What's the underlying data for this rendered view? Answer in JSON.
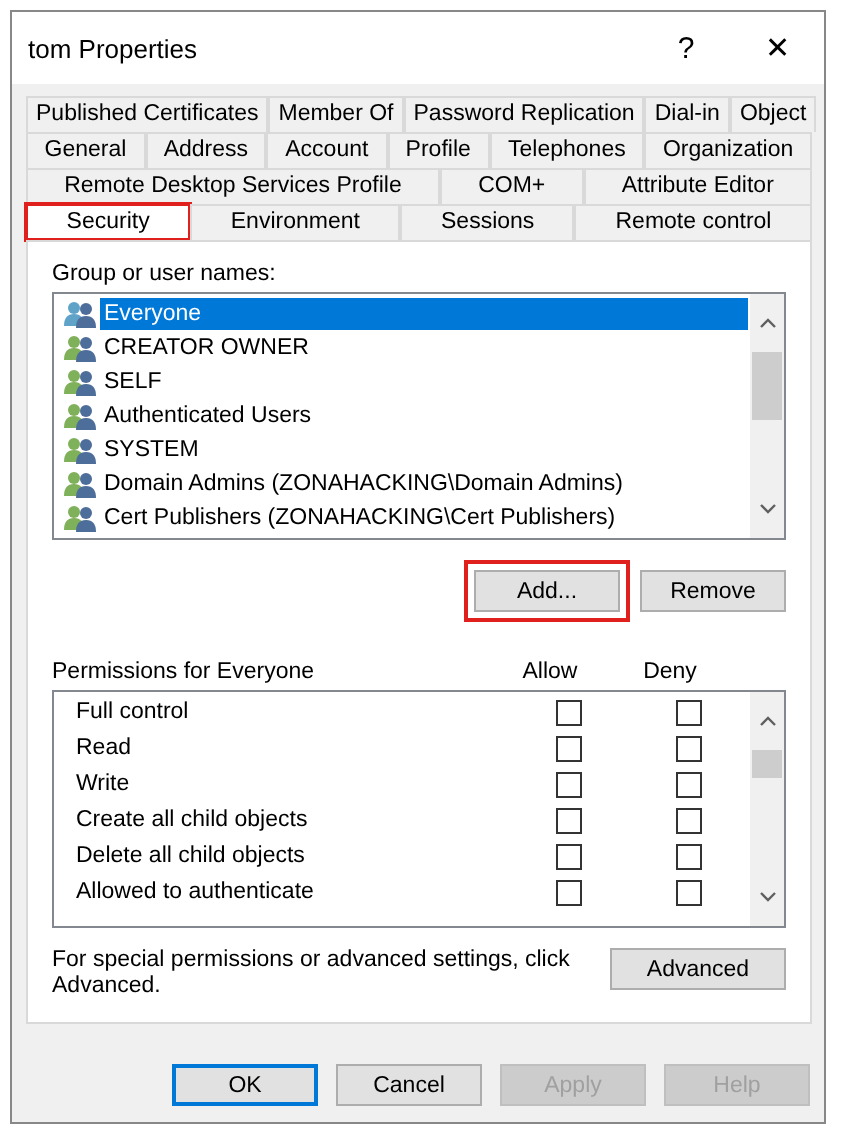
{
  "window": {
    "title": "tom Properties",
    "help_glyph": "?",
    "close_glyph": "✕"
  },
  "tab_rows": [
    [
      {
        "label": "Published Certificates",
        "selected": false,
        "highlighted": false
      },
      {
        "label": "Member Of",
        "selected": false,
        "highlighted": false
      },
      {
        "label": "Password Replication",
        "selected": false,
        "highlighted": false
      },
      {
        "label": "Dial-in",
        "selected": false,
        "highlighted": false
      },
      {
        "label": "Object",
        "selected": false,
        "highlighted": false
      }
    ],
    [
      {
        "label": "General",
        "selected": false,
        "highlighted": false
      },
      {
        "label": "Address",
        "selected": false,
        "highlighted": false
      },
      {
        "label": "Account",
        "selected": false,
        "highlighted": false
      },
      {
        "label": "Profile",
        "selected": false,
        "highlighted": false
      },
      {
        "label": "Telephones",
        "selected": false,
        "highlighted": false
      },
      {
        "label": "Organization",
        "selected": false,
        "highlighted": false
      }
    ],
    [
      {
        "label": "Remote Desktop Services Profile",
        "selected": false,
        "highlighted": false
      },
      {
        "label": "COM+",
        "selected": false,
        "highlighted": false
      },
      {
        "label": "Attribute Editor",
        "selected": false,
        "highlighted": false
      }
    ],
    [
      {
        "label": "Security",
        "selected": true,
        "highlighted": true
      },
      {
        "label": "Environment",
        "selected": false,
        "highlighted": false
      },
      {
        "label": "Sessions",
        "selected": false,
        "highlighted": false
      },
      {
        "label": "Remote control",
        "selected": false,
        "highlighted": false
      }
    ]
  ],
  "group_label": "Group or user names:",
  "users": [
    {
      "name": "Everyone",
      "selected": true
    },
    {
      "name": "CREATOR OWNER",
      "selected": false
    },
    {
      "name": "SELF",
      "selected": false
    },
    {
      "name": "Authenticated Users",
      "selected": false
    },
    {
      "name": "SYSTEM",
      "selected": false
    },
    {
      "name": "Domain Admins (ZONAHACKING\\Domain Admins)",
      "selected": false
    },
    {
      "name": "Cert Publishers (ZONAHACKING\\Cert Publishers)",
      "selected": false
    }
  ],
  "user_buttons": [
    {
      "label": "Add...",
      "highlighted": true
    },
    {
      "label": "Remove",
      "highlighted": false
    }
  ],
  "permissions_label": "Permissions for Everyone",
  "allow_header": "Allow",
  "deny_header": "Deny",
  "permissions": [
    {
      "name": "Full control",
      "allow": false,
      "deny": false
    },
    {
      "name": "Read",
      "allow": false,
      "deny": false
    },
    {
      "name": "Write",
      "allow": false,
      "deny": false
    },
    {
      "name": "Create all child objects",
      "allow": false,
      "deny": false
    },
    {
      "name": "Delete all child objects",
      "allow": false,
      "deny": false
    },
    {
      "name": "Allowed to authenticate",
      "allow": false,
      "deny": false
    }
  ],
  "advanced_note": "For special permissions or advanced settings, click Advanced.",
  "advanced_button": "Advanced",
  "buttons": [
    {
      "label": "OK",
      "default": true,
      "disabled": false
    },
    {
      "label": "Cancel",
      "default": false,
      "disabled": false
    },
    {
      "label": "Apply",
      "default": false,
      "disabled": true
    },
    {
      "label": "Help",
      "default": false,
      "disabled": true
    }
  ]
}
